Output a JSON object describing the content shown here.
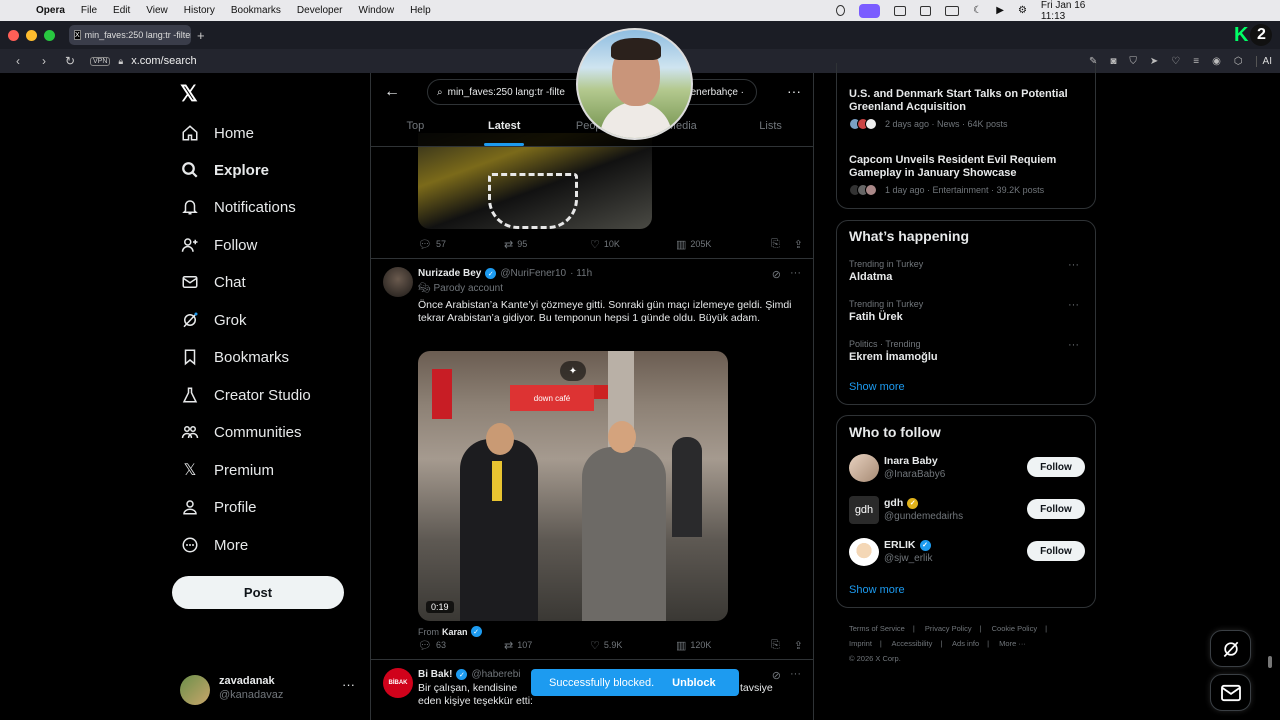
{
  "menubar": {
    "app": "Opera",
    "items": [
      "File",
      "Edit",
      "View",
      "History",
      "Bookmarks",
      "Developer",
      "Window",
      "Help"
    ],
    "clock": "Fri Jan 16  11:13"
  },
  "browser": {
    "tab_title": "min_faves:250 lang:tr -filter",
    "url": "x.com/search",
    "vpn": "VPN",
    "ai": "AI",
    "k2_badge": "2"
  },
  "sidebar": {
    "nav": [
      {
        "label": "Home",
        "icon": "home-icon"
      },
      {
        "label": "Explore",
        "icon": "search-icon"
      },
      {
        "label": "Notifications",
        "icon": "bell-icon"
      },
      {
        "label": "Follow",
        "icon": "person-add-icon"
      },
      {
        "label": "Chat",
        "icon": "mail-icon"
      },
      {
        "label": "Grok",
        "icon": "grok-icon"
      },
      {
        "label": "Bookmarks",
        "icon": "bookmark-icon"
      },
      {
        "label": "Creator Studio",
        "icon": "flask-icon"
      },
      {
        "label": "Communities",
        "icon": "people-icon"
      },
      {
        "label": "Premium",
        "icon": "x-icon"
      },
      {
        "label": "Profile",
        "icon": "person-icon"
      },
      {
        "label": "More",
        "icon": "more-circle-icon"
      }
    ],
    "post_button": "Post",
    "account": {
      "name": "zavadanak",
      "handle": "@kanadavaz"
    }
  },
  "search": {
    "query_left": "min_faves:250 lang:tr -filte",
    "query_right": "enerbahçe ·",
    "tabs": [
      "Top",
      "Latest",
      "People",
      "Media",
      "Lists"
    ],
    "active_tab": "Latest"
  },
  "prev_tweet_actions": {
    "replies": "57",
    "reposts": "95",
    "likes": "10K",
    "views": "205K"
  },
  "tweet1": {
    "name": "Nurizade Bey",
    "handle": "@NuriFener10",
    "time": "· 11h",
    "parody": "Parody account",
    "text": "Önce Arabistan’a Kante’yi çözmeye gitti. Sonraki gün maçı izlemeye geldi. Şimdi tekrar Arabistan’a gidiyor. Bu temponun hepsi 1 günde oldu. Büyük adam.",
    "video_duration": "0:19",
    "store_sign": "down café",
    "from_label": "From",
    "from_name": "Karan",
    "actions": {
      "replies": "63",
      "reposts": "107",
      "likes": "5.9K",
      "views": "120K"
    }
  },
  "tweet2": {
    "name": "Bi Bak!",
    "handle": "@haberebi",
    "avatar_text": "BİBAK",
    "text_line1": "Bir çalışan, kendisine",
    "text_line1_end": "tavsiye",
    "text_line2": "eden kişiye teşekkür etti:"
  },
  "toast": {
    "message": "Successfully blocked.",
    "action": "Unblock"
  },
  "news": [
    {
      "title": "U.S. and Denmark Start Talks on Potential Greenland Acquisition",
      "meta": "2 days ago · News · 64K posts"
    },
    {
      "title": "Capcom Unveils Resident Evil Requiem Gameplay in January Showcase",
      "meta": "1 day ago · Entertainment · 39.2K posts"
    }
  ],
  "happening": {
    "title": "What’s happening",
    "trends": [
      {
        "context": "Trending in Turkey",
        "name": "Aldatma"
      },
      {
        "context": "Trending in Turkey",
        "name": "Fatih Ürek"
      },
      {
        "context": "Politics · Trending",
        "name": "Ekrem İmamoğlu"
      }
    ],
    "show_more": "Show more"
  },
  "who_to_follow": {
    "title": "Who to follow",
    "users": [
      {
        "name": "Inara Baby",
        "handle": "@InaraBaby6",
        "badge": "none"
      },
      {
        "name": "gdh",
        "handle": "@gundemedairhs",
        "badge": "gold"
      },
      {
        "name": "ERLIK",
        "handle": "@sjw_erlik",
        "badge": "blue"
      }
    ],
    "follow_label": "Follow",
    "gdh_avatar_text": "gdh",
    "show_more": "Show more"
  },
  "footer": {
    "links": [
      "Terms of Service",
      "|",
      "Privacy Policy",
      "|",
      "Cookie Policy",
      "|",
      "Imprint",
      "|",
      "Accessibility",
      "|",
      "Ads info",
      "|",
      "More ···"
    ],
    "copyright": "© 2026 X Corp."
  },
  "colors": {
    "accent": "#1d9bf0",
    "background": "#000000",
    "border": "#2f3336",
    "muted": "#71767b"
  }
}
